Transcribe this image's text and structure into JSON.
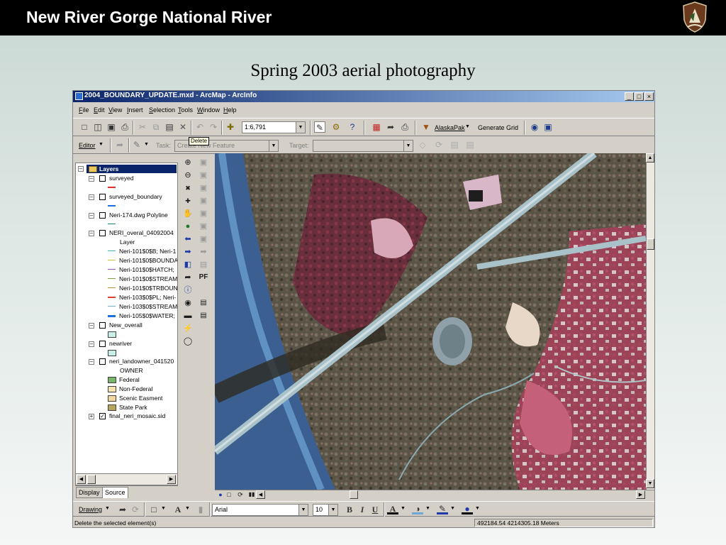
{
  "slide": {
    "header_title": "New River Gorge National River",
    "subtitle": "Spring 2003 aerial photography"
  },
  "window": {
    "title": "2004_BOUNDARY_UPDATE.mxd - ArcMap - ArcInfo",
    "minimize": "_",
    "maximize": "□",
    "close": "×"
  },
  "menu": [
    "File",
    "Edit",
    "View",
    "Insert",
    "Selection",
    "Tools",
    "Window",
    "Help"
  ],
  "toolbar": {
    "scale": "1:6,791",
    "alaskapak": "AlaskaPak",
    "generate_grid": "Generate Grid",
    "tooltip": "Delete"
  },
  "editor_toolbar": {
    "editor": "Editor",
    "task_label": "Task:",
    "task_value": "Create New Feature",
    "target_label": "Target:",
    "target_value": ""
  },
  "toc": {
    "root": "Layers",
    "layers": [
      {
        "name": "surveyed",
        "checked": false,
        "symbol": "line",
        "color": "#e03020"
      },
      {
        "name": "surveyed_boundary",
        "checked": false,
        "symbol": "line",
        "color": "#1e6fe0"
      },
      {
        "name": "Neri-174.dwg Polyline",
        "checked": false,
        "symbol": "line",
        "color": "#208080"
      },
      {
        "name": "NERI_overal_04092004",
        "checked": false,
        "symbol": "group"
      },
      {
        "name": "New_overall",
        "checked": false,
        "symbol": "box",
        "color": "#c8eee8"
      },
      {
        "name": "newriver",
        "checked": false,
        "symbol": "box",
        "color": "#c8eee8"
      },
      {
        "name": "neri_landowner_041520",
        "checked": false,
        "symbol": "group"
      },
      {
        "name": "final_neri_mosaic.sid",
        "checked": true,
        "symbol": "none"
      }
    ],
    "group_heading": "Layer",
    "sublayers": [
      {
        "name": "Neri-101$0$B; Neri-1",
        "color": "#4ab0c8"
      },
      {
        "name": "Neri-101$0$BOUNDA",
        "color": "#e0c040"
      },
      {
        "name": "Neri-101$0$HATCH;",
        "color": "#9a50c0"
      },
      {
        "name": "Neri-101$0$STREAM",
        "color": "#80a040"
      },
      {
        "name": "Neri-101$0$TRBOUN",
        "color": "#c09040"
      },
      {
        "name": "Neri-103$0$PL; Neri-",
        "color": "#e04030"
      },
      {
        "name": "Neri-103$0$STREAM",
        "color": "#70b0d0"
      },
      {
        "name": "Neri-105$0$WATER;",
        "color": "#1e6fe0"
      }
    ],
    "owner_heading": "OWNER",
    "owners": [
      {
        "name": "Federal",
        "color": "#7ab66a"
      },
      {
        "name": "Non-Federal",
        "color": "#f5e6b0"
      },
      {
        "name": "Scenic Easment",
        "color": "#f0d8a0"
      },
      {
        "name": "State Park",
        "color": "#b8a45a"
      }
    ],
    "tabs": [
      "Display",
      "Source"
    ]
  },
  "drawing_toolbar": {
    "drawing": "Drawing",
    "font": "Arial",
    "size": "10",
    "bold": "B",
    "italic": "I",
    "underline": "U",
    "font_color_glyph": "A"
  },
  "status": {
    "message": "Delete the selected element(s)",
    "coords": "492184.54  4214305.18 Meters"
  }
}
